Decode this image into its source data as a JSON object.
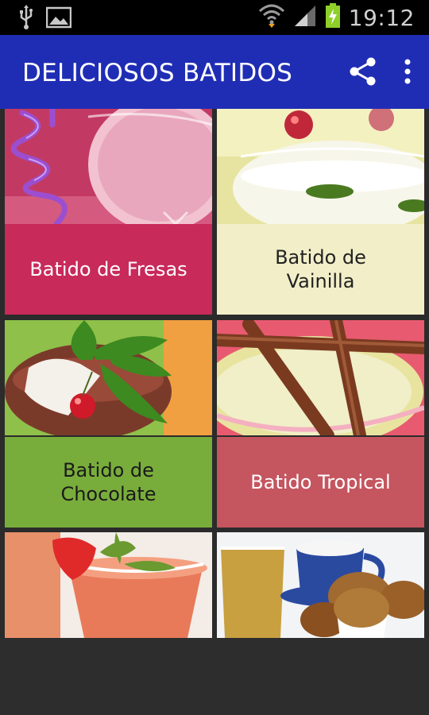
{
  "status_bar": {
    "time": "19:12",
    "icons": [
      "usb-icon",
      "image-icon",
      "wifi-icon",
      "signal-icon",
      "battery-charging-icon"
    ]
  },
  "app_bar": {
    "title": "DELICIOSOS BATIDOS",
    "actions": [
      "share-icon",
      "overflow-menu-icon"
    ]
  },
  "recipes": [
    {
      "label": "Batido de Fresas",
      "caption_bg": "#c82a5a",
      "caption_color": "#ffffff"
    },
    {
      "label": "Batido de Vainilla",
      "caption_bg": "#f2eec8",
      "caption_color": "#222222"
    },
    {
      "label": "Batido de Chocolate",
      "caption_bg": "#79ad3b",
      "caption_color": "#1a1a1a"
    },
    {
      "label": "Batido Tropical",
      "caption_bg": "#c5555f",
      "caption_color": "#ffffff"
    },
    {
      "label": "",
      "caption_bg": "",
      "caption_color": ""
    },
    {
      "label": "",
      "caption_bg": "",
      "caption_color": ""
    }
  ]
}
